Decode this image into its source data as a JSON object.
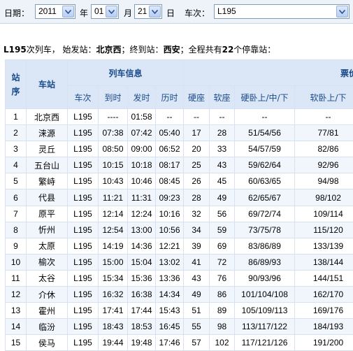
{
  "search": {
    "date_label": "日期：",
    "year_value": "2011",
    "year_unit": "年",
    "month_value": "01",
    "month_unit": "月",
    "day_value": "21",
    "day_unit": "日",
    "train_label": "车次：",
    "train_value": "L195"
  },
  "summary": {
    "train": "L195",
    "t1": "次列车，  始发站：",
    "origin": "北京西",
    "t2": "；终到站：",
    "terminus": "西安",
    "t3": "；全程共有",
    "stop_count": "22",
    "t4": "个停靠站："
  },
  "table": {
    "header": {
      "seq": "站序",
      "station": "车站",
      "train_info": "列车信息",
      "fare": "票价",
      "train_no": "车次",
      "arrive": "到时",
      "depart": "发时",
      "elapsed": "历时",
      "hard_seat": "硬座",
      "soft_seat": "软座",
      "hard_sleeper": "硬卧上/中/下",
      "soft_sleeper": "软卧上/下"
    },
    "rows": [
      {
        "seq": "1",
        "station": "北京西",
        "train": "L195",
        "arrive": "----",
        "depart": "01:58",
        "elapsed": "--",
        "hard_seat": "--",
        "soft_seat": "--",
        "hard_sleeper": "--",
        "soft_sleeper": "--"
      },
      {
        "seq": "2",
        "station": "涞源",
        "train": "L195",
        "arrive": "07:38",
        "depart": "07:42",
        "elapsed": "05:40",
        "hard_seat": "17",
        "soft_seat": "28",
        "hard_sleeper": "51/54/56",
        "soft_sleeper": "77/81"
      },
      {
        "seq": "3",
        "station": "灵丘",
        "train": "L195",
        "arrive": "08:50",
        "depart": "09:00",
        "elapsed": "06:52",
        "hard_seat": "20",
        "soft_seat": "33",
        "hard_sleeper": "54/57/59",
        "soft_sleeper": "82/86"
      },
      {
        "seq": "4",
        "station": "五台山",
        "train": "L195",
        "arrive": "10:15",
        "depart": "10:18",
        "elapsed": "08:17",
        "hard_seat": "25",
        "soft_seat": "43",
        "hard_sleeper": "59/62/64",
        "soft_sleeper": "92/96"
      },
      {
        "seq": "5",
        "station": "繁峙",
        "train": "L195",
        "arrive": "10:43",
        "depart": "10:46",
        "elapsed": "08:45",
        "hard_seat": "26",
        "soft_seat": "45",
        "hard_sleeper": "60/63/65",
        "soft_sleeper": "94/98"
      },
      {
        "seq": "6",
        "station": "代县",
        "train": "L195",
        "arrive": "11:21",
        "depart": "11:31",
        "elapsed": "09:23",
        "hard_seat": "28",
        "soft_seat": "49",
        "hard_sleeper": "62/65/67",
        "soft_sleeper": "98/102"
      },
      {
        "seq": "7",
        "station": "原平",
        "train": "L195",
        "arrive": "12:14",
        "depart": "12:24",
        "elapsed": "10:16",
        "hard_seat": "32",
        "soft_seat": "56",
        "hard_sleeper": "69/72/74",
        "soft_sleeper": "109/114"
      },
      {
        "seq": "8",
        "station": "忻州",
        "train": "L195",
        "arrive": "12:54",
        "depart": "13:00",
        "elapsed": "10:56",
        "hard_seat": "34",
        "soft_seat": "59",
        "hard_sleeper": "73/75/78",
        "soft_sleeper": "115/120"
      },
      {
        "seq": "9",
        "station": "太原",
        "train": "L195",
        "arrive": "14:19",
        "depart": "14:36",
        "elapsed": "12:21",
        "hard_seat": "39",
        "soft_seat": "69",
        "hard_sleeper": "83/86/89",
        "soft_sleeper": "133/139"
      },
      {
        "seq": "10",
        "station": "榆次",
        "train": "L195",
        "arrive": "15:00",
        "depart": "15:04",
        "elapsed": "13:02",
        "hard_seat": "41",
        "soft_seat": "72",
        "hard_sleeper": "86/89/93",
        "soft_sleeper": "138/144"
      },
      {
        "seq": "11",
        "station": "太谷",
        "train": "L195",
        "arrive": "15:34",
        "depart": "15:36",
        "elapsed": "13:36",
        "hard_seat": "43",
        "soft_seat": "76",
        "hard_sleeper": "90/93/96",
        "soft_sleeper": "144/151"
      },
      {
        "seq": "12",
        "station": "介休",
        "train": "L195",
        "arrive": "16:32",
        "depart": "16:38",
        "elapsed": "14:34",
        "hard_seat": "49",
        "soft_seat": "86",
        "hard_sleeper": "101/104/108",
        "soft_sleeper": "162/170"
      },
      {
        "seq": "13",
        "station": "霍州",
        "train": "L195",
        "arrive": "17:41",
        "depart": "17:44",
        "elapsed": "15:43",
        "hard_seat": "51",
        "soft_seat": "89",
        "hard_sleeper": "105/109/113",
        "soft_sleeper": "169/176"
      },
      {
        "seq": "14",
        "station": "临汾",
        "train": "L195",
        "arrive": "18:43",
        "depart": "18:53",
        "elapsed": "16:45",
        "hard_seat": "55",
        "soft_seat": "98",
        "hard_sleeper": "113/117/122",
        "soft_sleeper": "184/193"
      },
      {
        "seq": "15",
        "station": "侯马",
        "train": "L195",
        "arrive": "19:44",
        "depart": "19:48",
        "elapsed": "17:46",
        "hard_seat": "57",
        "soft_seat": "102",
        "hard_sleeper": "117/121/126",
        "soft_sleeper": "191/200"
      }
    ]
  },
  "icons": {
    "dropdown": "chevron-down-icon"
  },
  "colors": {
    "header_bg": "#dbe7f6",
    "header_text": "#1a4a8a",
    "grid": "#d7e2f0",
    "row_alt": "#f1f6fc"
  }
}
